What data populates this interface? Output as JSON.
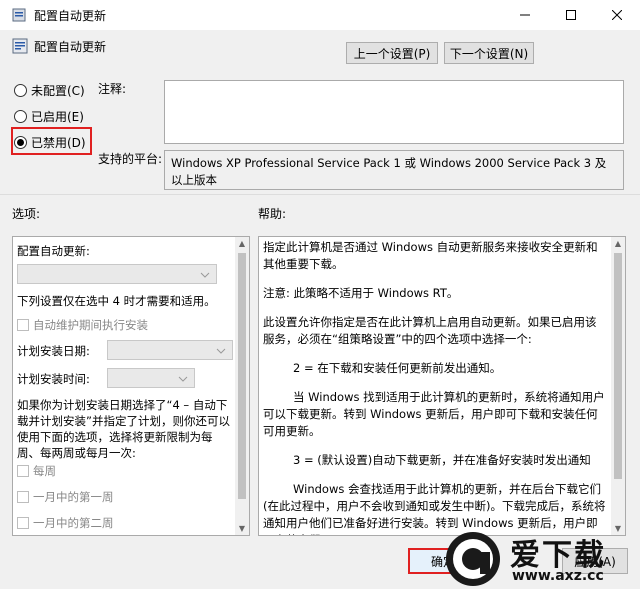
{
  "window": {
    "title": "配置自动更新"
  },
  "header": {
    "title": "配置自动更新",
    "prev_label": "上一个设置(P)",
    "next_label": "下一个设置(N)"
  },
  "state": {
    "not_configured": "未配置(C)",
    "enabled": "已启用(E)",
    "disabled": "已禁用(D)",
    "selected": "disabled"
  },
  "comment": {
    "label": "注释:",
    "value": ""
  },
  "supported": {
    "label": "支持的平台:",
    "value": "Windows XP Professional Service Pack 1 或 Windows 2000 Service Pack 3 及以上版本"
  },
  "options": {
    "label": "选项:",
    "configure_label": "配置自动更新:",
    "configure_value": "",
    "note": "下列设置仅在选中 4 时才需要和适用。",
    "maintenance_label": "自动维护期间执行安装",
    "install_day_label": "计划安装日期:",
    "install_time_label": "计划安装时间:",
    "description": "如果你为计划安装日期选择了“4 – 自动下载并计划安装”并指定了计划，则你还可以使用下面的选项，选择将更新限制为每周、每两周或每月一次:",
    "weekly_label": "每周",
    "first_week_label": "一月中的第一周",
    "second_week_label": "一月中的第二周"
  },
  "help": {
    "label": "帮助:",
    "paragraphs": [
      "指定此计算机是否通过 Windows 自动更新服务来接收安全更新和其他重要下载。",
      "注意: 此策略不适用于 Windows RT。",
      "此设置允许你指定是否在此计算机上启用自动更新。如果已启用该服务，必须在“组策略设置”中的四个选项中选择一个:",
      "2 = 在下载和安装任何更新前发出通知。",
      "当 Windows 找到适用于此计算机的更新时，系统将通知用户可以下载更新。转到 Windows 更新后，用户即可下载和安装任何可用更新。",
      "3 = (默认设置)自动下载更新，并在准备好安装时发出通知",
      "Windows 会查找适用于此计算机的更新，并在后台下载它们(在此过程中，用户不会收到通知或发生中断)。下载完成后，系统将通知用户他们已准备好进行安装。转到 Windows 更新后，用户即可安装它们。"
    ]
  },
  "footer": {
    "ok_label": "确定",
    "apply_label": "应用(A)"
  },
  "watermark": {
    "brand": "爱下载",
    "url": "www.axz.cc"
  }
}
